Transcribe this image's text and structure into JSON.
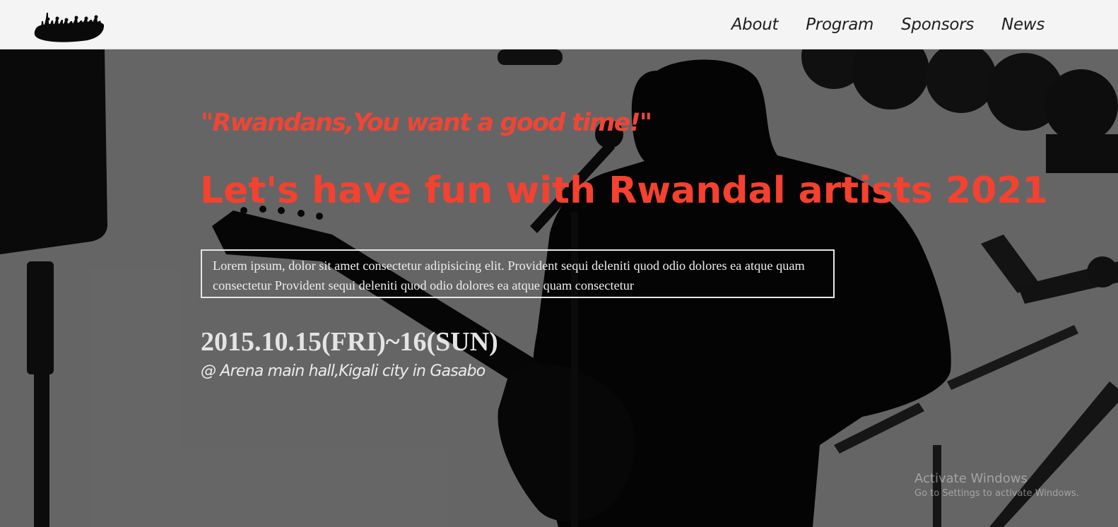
{
  "nav": {
    "logo_icon": "crowd-silhouette-logo",
    "links": [
      "About",
      "Program",
      "Sponsors",
      "News"
    ]
  },
  "hero": {
    "tagline": "\"Rwandans,You want a good time!\"",
    "headline": "Let's have fun with Rwandal artists 2021",
    "description": "Lorem ipsum, dolor sit amet consectetur adipisicing elit. Provident sequi deleniti quod odio dolores ea atque quam consectetur Provident sequi deleniti quod odio dolores ea atque quam consectetur",
    "date": "2015.10.15(FRI)~16(SUN)",
    "venue": "@ Arena main hall,Kigali city in Gasabo",
    "background_icon": "guitarist-on-stage-photo"
  },
  "watermark": {
    "title": "Activate Windows",
    "subtitle": "Go to Settings to activate Windows."
  },
  "colors": {
    "accent": "#f5412f",
    "nav_background": "#f4f4f4",
    "hero_background": "#6c6c6c"
  }
}
